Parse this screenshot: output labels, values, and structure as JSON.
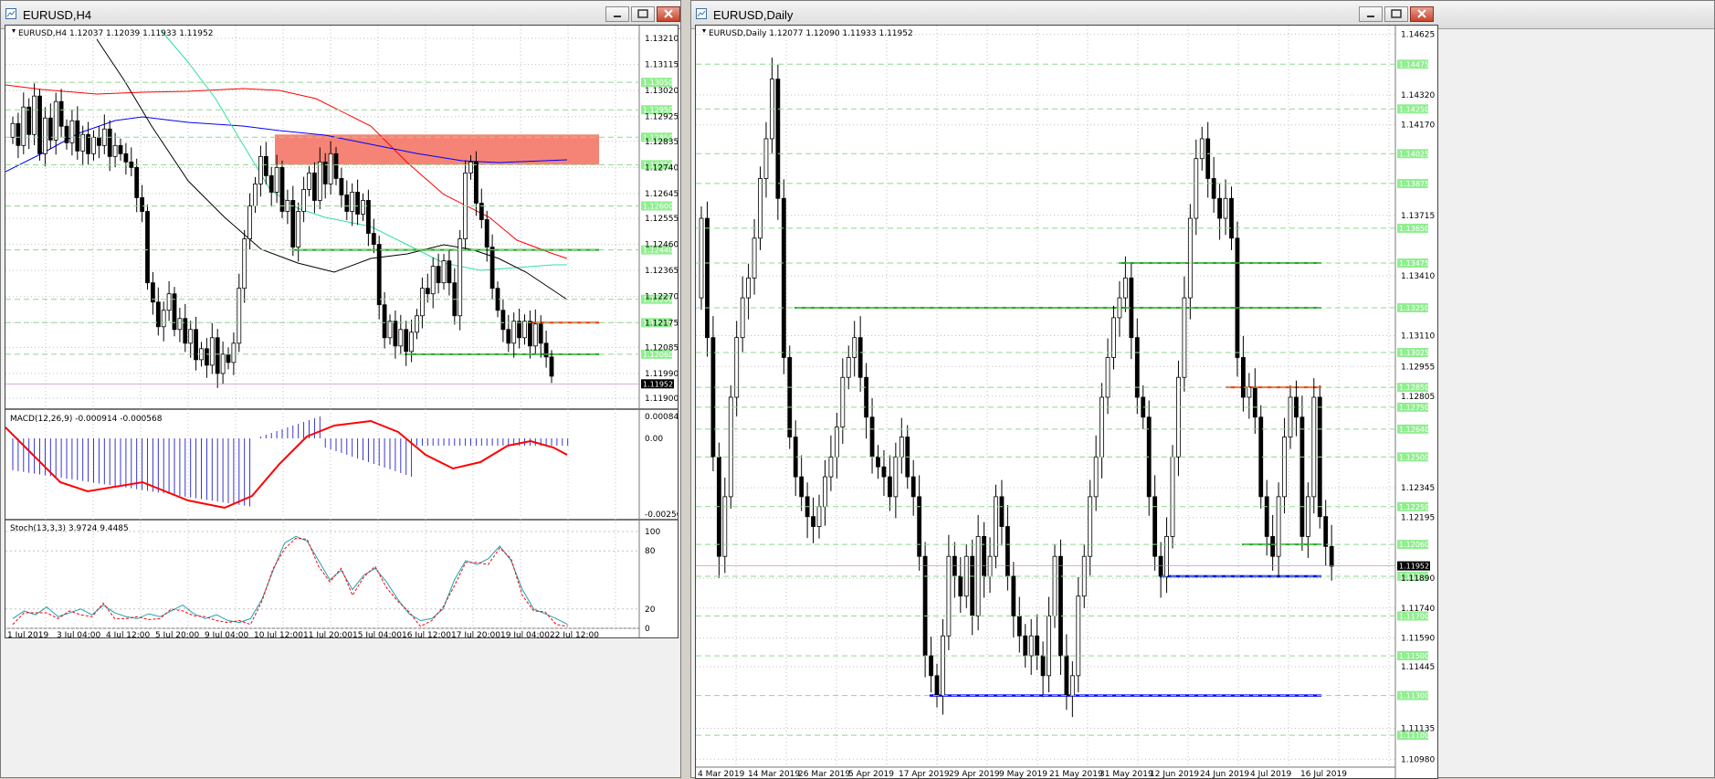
{
  "left_window": {
    "title": "EURUSD,H4",
    "header": "EURUSD,H4  1.12037 1.12039 1.11933 1.11952",
    "macd_label": "MACD(12,26,9) -0.000914 -0.000568",
    "stoch_label": "Stoch(13,3,3) 3.9724 9.4485",
    "price_ticks": [
      "1.13210",
      "1.13115",
      "1.13020",
      "1.12925",
      "1.12835",
      "1.12740",
      "1.12645",
      "1.12555",
      "1.12460",
      "1.12365",
      "1.12270",
      "1.12175",
      "1.12085",
      "1.11990",
      "1.11900"
    ],
    "level_labels": [
      "1.13050",
      "1.12950",
      "1.12850",
      "1.12750",
      "1.12600",
      "1.12440",
      "1.12260",
      "1.12175",
      "1.12060"
    ],
    "current_price": "1.11952",
    "macd_ticks": [
      "0.00084",
      "0.00",
      "-0.002563"
    ],
    "stoch_ticks": [
      "100",
      "80",
      "20",
      "0"
    ],
    "time_labels": [
      "1 Jul 2019",
      "3 Jul 04:00",
      "4 Jul 12:00",
      "5 Jul 20:00",
      "9 Jul 04:00",
      "10 Jul 12:00",
      "11 Jul 20:00",
      "15 Jul 04:00",
      "16 Jul 12:00",
      "17 Jul 20:00",
      "19 Jul 04:00",
      "22 Jul 12:00"
    ]
  },
  "right_window": {
    "title": "EURUSD,Daily",
    "header": "EURUSD,Daily  1.12077 1.12090 1.11933 1.11952",
    "price_ticks": [
      "1.14625",
      "1.14320",
      "1.14170",
      "1.13715",
      "1.13410",
      "1.13110",
      "1.12955",
      "1.12805",
      "1.12345",
      "1.12195",
      "1.11890",
      "1.11740",
      "1.11590",
      "1.11445",
      "1.11135",
      "1.10980"
    ],
    "level_labels": [
      "1.14475",
      "1.14250",
      "1.14025",
      "1.13875",
      "1.13650",
      "1.13475",
      "1.13250",
      "1.13025",
      "1.12850",
      "1.12750",
      "1.12640",
      "1.12500",
      "1.12250",
      "1.12060",
      "1.11900",
      "1.11700",
      "1.11500",
      "1.11300",
      "1.11100"
    ],
    "current_price": "1.11952",
    "time_labels": [
      "4 Mar 2019",
      "14 Mar 2019",
      "26 Mar 2019",
      "5 Apr 2019",
      "17 Apr 2019",
      "29 Apr 2019",
      "9 May 2019",
      "21 May 2019",
      "31 May 2019",
      "12 Jun 2019",
      "24 Jun 2019",
      "4 Jul 2019",
      "16 Jul 2019"
    ]
  },
  "colors": {
    "bull": "#ffffff",
    "bear": "#000000",
    "support": "#22aa22",
    "resistance": "#ff3300",
    "zone": "#f46e5e",
    "level_tag": "#90ee90",
    "blue": "#0000ff",
    "grid": "#c0c0c0"
  }
}
